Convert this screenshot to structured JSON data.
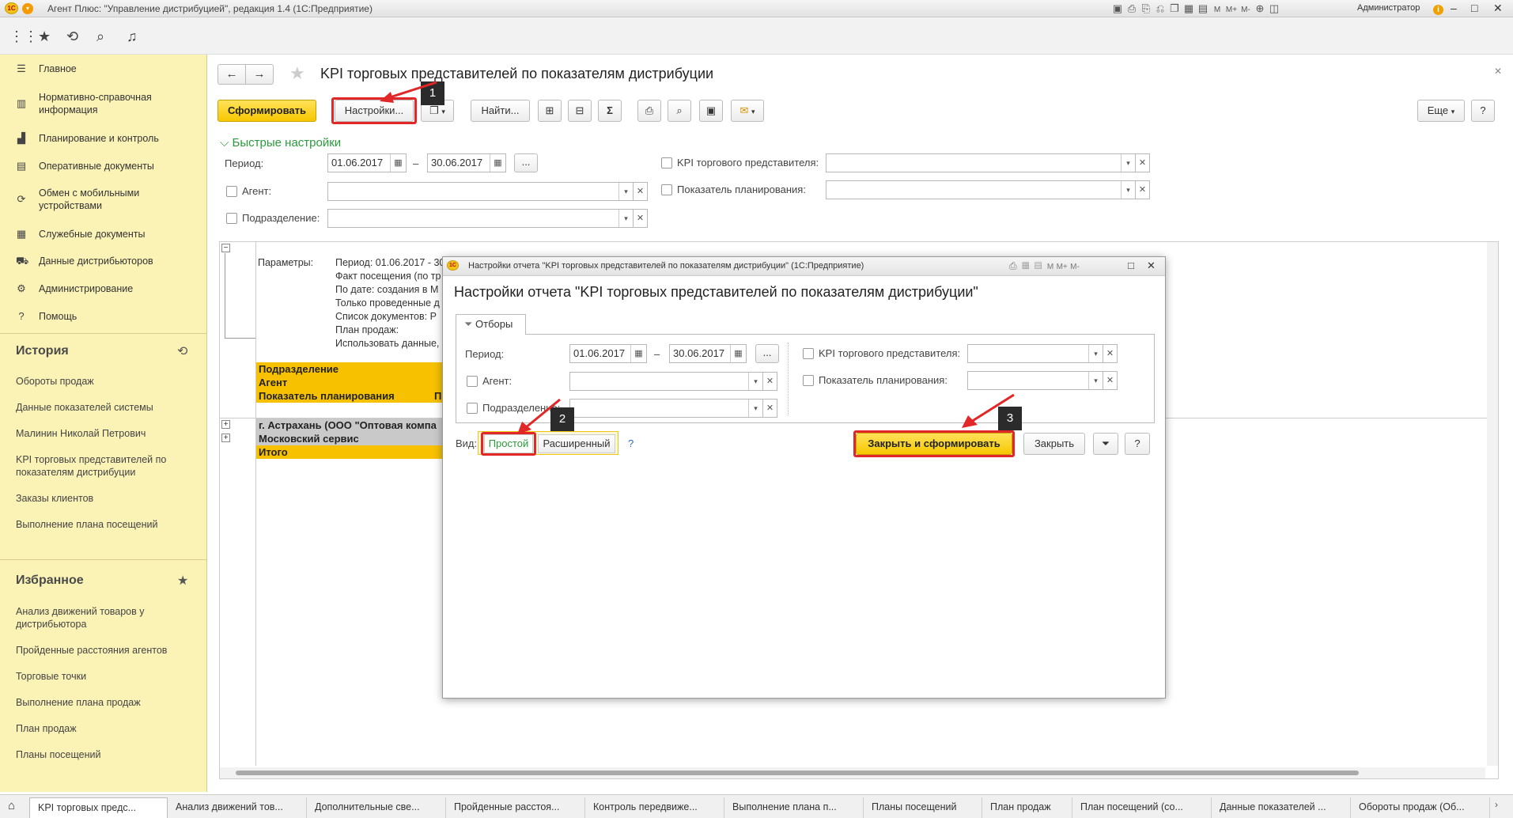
{
  "window": {
    "title": "Агент Плюс: \"Управление дистрибуцией\", редакция 1.4  (1С:Предприятие)",
    "user": "Администратор"
  },
  "sidebar": {
    "items": [
      {
        "label": "Главное",
        "icon": "menu-lines-icon"
      },
      {
        "label": "Нормативно-справочная информация",
        "icon": "bars-icon"
      },
      {
        "label": "Планирование и контроль",
        "icon": "chart-icon"
      },
      {
        "label": "Оперативные документы",
        "icon": "document-icon"
      },
      {
        "label": "Обмен с мобильными устройствами",
        "icon": "sync-icon"
      },
      {
        "label": "Служебные документы",
        "icon": "documents-icon"
      },
      {
        "label": "Данные дистрибьюторов",
        "icon": "truck-icon"
      },
      {
        "label": "Администрирование",
        "icon": "gear-icon"
      },
      {
        "label": "Помощь",
        "icon": "question-icon"
      }
    ],
    "history_title": "История",
    "history": [
      "Обороты продаж",
      "Данные показателей системы",
      "Малинин Николай Петрович",
      "KPI торговых представителей по показателям дистрибуции",
      "Заказы клиентов",
      "Выполнение плана посещений"
    ],
    "favorites_title": "Избранное",
    "favorites": [
      "Анализ движений товаров у дистрибьютора",
      "Пройденные расстояния агентов",
      "Торговые точки",
      "Выполнение плана продаж",
      "План продаж",
      "Планы посещений"
    ]
  },
  "form": {
    "title": "KPI торговых представителей по показателям дистрибуции",
    "generate_button": "Сформировать",
    "settings_button": "Настройки...",
    "find_button": "Найти...",
    "more_button": "Еще",
    "help_button": "?",
    "quick_settings": "Быстрые настройки",
    "period_label": "Период:",
    "period_from": "01.06.2017",
    "period_to": "30.06.2017",
    "period_dash": "–",
    "ellipsis": "...",
    "agent_label": "Агент:",
    "subdivision_label": "Подразделение:",
    "kpi_label": "KPI торгового представителя:",
    "indicator_label": "Показатель планирования:"
  },
  "report": {
    "params_label": "Параметры:",
    "params_lines": [
      "Период: 01.06.2017 - 30",
      "Факт посещения (по тр",
      "По дате: создания в М",
      "Только проведенные д",
      "Список документов: Р",
      "План продаж:",
      "Использовать данные,"
    ],
    "header_rows": [
      "Подразделение",
      "Агент",
      "Показатель планирования"
    ],
    "header_col2": "П",
    "group_rows": [
      "г. Астрахань (ООО \"Оптовая компа",
      "Московский сервис"
    ],
    "total_row": "Итого"
  },
  "modal": {
    "window_title": "Настройки отчета \"KPI торговых представителей по показателям дистрибуции\"  (1С:Предприятие)",
    "heading": "Настройки отчета \"KPI торговых представителей по показателям дистрибуции\"",
    "tab_filters": "Отборы",
    "period_label": "Период:",
    "period_from": "01.06.2017",
    "period_to": "30.06.2017",
    "agent_label": "Агент:",
    "subdivision_label": "Подразделение:",
    "kpi_label": "KPI торгового представителя:",
    "indicator_label": "Показатель планирования:",
    "view_label": "Вид:",
    "view_simple": "Простой",
    "view_extended": "Расширенный",
    "view_help": "?",
    "close_generate": "Закрыть и сформировать",
    "close": "Закрыть",
    "help": "?"
  },
  "annotations": [
    "1",
    "2",
    "3"
  ],
  "tabs": [
    "KPI торговых предс...",
    "Анализ движений тов...",
    "Дополнительные све...",
    "Пройденные расстоя...",
    "Контроль передвиже...",
    "Выполнение плана п...",
    "Планы посещений",
    "План продаж",
    "План посещений  (со...",
    "Данные показателей ...",
    "Обороты продаж (Об..."
  ],
  "colors": {
    "accent_yellow": "#f7c800",
    "sidebar": "#fbf2b6",
    "annotation_red": "#e12727",
    "link_green": "#2a9a3a"
  }
}
